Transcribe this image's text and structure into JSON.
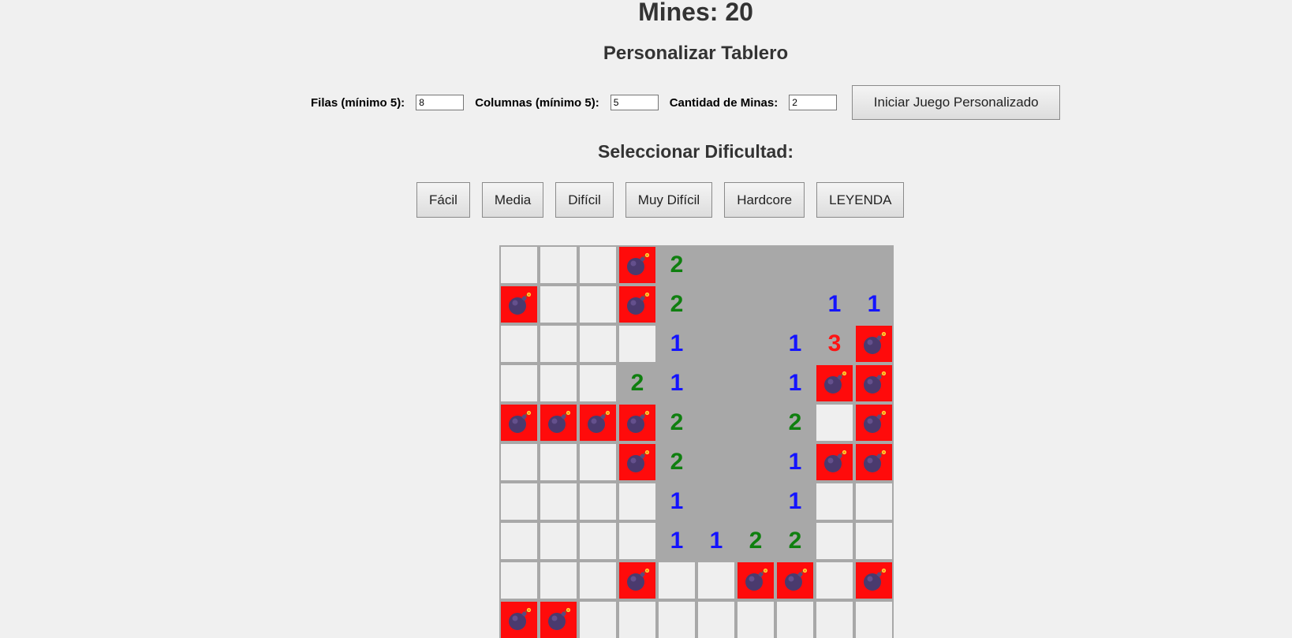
{
  "header": {
    "mines_label": "Mines: 20"
  },
  "custom": {
    "title": "Personalizar Tablero",
    "rows_label": "Filas (mínimo 5):",
    "rows_value": "8",
    "cols_label": "Columnas (mínimo 5):",
    "cols_value": "5",
    "mines_label": "Cantidad de Minas:",
    "mines_value": "2",
    "start_button": "Iniciar Juego Personalizado"
  },
  "difficulty": {
    "title": "Seleccionar Dificultad:",
    "buttons": [
      "Fácil",
      "Media",
      "Difícil",
      "Muy Difícil",
      "Hardcore",
      "LEYENDA"
    ]
  },
  "colors": {
    "mine_bg": "#ff0b0b",
    "hidden_bg": "#efefef",
    "revealed_bg": "#a8a8a8",
    "num_1": "#1414ff",
    "num_2": "#0f7f0f",
    "num_3": "#ff1414"
  },
  "board": {
    "legend": "H = hidden, M = mine, R = revealed empty, digits = revealed count",
    "rows": [
      [
        "H",
        "H",
        "H",
        "M",
        "2",
        "R",
        "R",
        "R",
        "R",
        "R"
      ],
      [
        "M",
        "H",
        "H",
        "M",
        "2",
        "R",
        "R",
        "R",
        "1",
        "1"
      ],
      [
        "H",
        "H",
        "H",
        "H",
        "1",
        "R",
        "R",
        "1",
        "3",
        "M"
      ],
      [
        "H",
        "H",
        "H",
        "2",
        "1",
        "R",
        "R",
        "1",
        "M",
        "M"
      ],
      [
        "M",
        "M",
        "M",
        "M",
        "2",
        "R",
        "R",
        "2",
        "H",
        "M"
      ],
      [
        "H",
        "H",
        "H",
        "M",
        "2",
        "R",
        "R",
        "1",
        "M",
        "M"
      ],
      [
        "H",
        "H",
        "H",
        "H",
        "1",
        "R",
        "R",
        "1",
        "H",
        "H"
      ],
      [
        "H",
        "H",
        "H",
        "H",
        "1",
        "1",
        "2",
        "2",
        "H",
        "H"
      ],
      [
        "H",
        "H",
        "H",
        "M",
        "H",
        "H",
        "M",
        "M",
        "H",
        "M"
      ],
      [
        "M",
        "M",
        "H",
        "H",
        "H",
        "H",
        "H",
        "H",
        "H",
        "H"
      ]
    ]
  }
}
